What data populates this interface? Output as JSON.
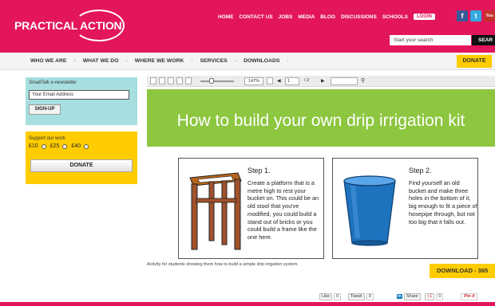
{
  "header": {
    "logo": "PRACTICAL ACTION",
    "nav": [
      "HOME",
      "CONTACT US",
      "JOBS",
      "MEDIA",
      "BLOG",
      "DISCUSSIONS",
      "SCHOOLS"
    ],
    "login_label": "LOGIN",
    "search_placeholder": "Start your search",
    "search_button": "SEAR",
    "social": {
      "facebook": "f",
      "twitter": "t",
      "youtube": "You"
    },
    "brand_color": "#e3165b"
  },
  "mainnav": {
    "items": [
      "WHO WE ARE",
      "WHAT WE DO",
      "WHERE WE WORK",
      "SERVICES",
      "DOWNLOADS"
    ],
    "separator": "›",
    "donate": "DONATE"
  },
  "sidebar": {
    "newsletter": {
      "title": "SmallTalk e-newsletter",
      "email_value": "Your Email Address",
      "signup": "SIGN-UP"
    },
    "support": {
      "title": "Support our work",
      "amounts": [
        "£10",
        "£25",
        "£40"
      ],
      "donate": "DONATE"
    }
  },
  "viewer": {
    "zoom": "147%",
    "page": "1",
    "of": "/ 2",
    "prev": "◀",
    "next": "▶",
    "search_icon": "🔍"
  },
  "document": {
    "title": "How to build your own drip irrigation kit",
    "steps": [
      {
        "head": "Step 1.",
        "text": "Create a platform that is a metre high to rest your bucket on. This could be an old stool that you've modified, you could build a stand out of bricks or you could build a frame like the one here."
      },
      {
        "head": "Step 2.",
        "text": "Find yourself an old bucket and make three holes in the bottom of it, big enough to fit a piece of hosepipe through, but not too big that it falls out."
      }
    ],
    "green": "#8dc63f"
  },
  "caption": "Activity for students showing them how to build a simple drip irrigation system.",
  "download": "DOWNLOAD - 365",
  "share": {
    "like": "Like",
    "like_count": "0",
    "tweet": "Tweet",
    "tweet_count": "0",
    "linkedin": "in",
    "linkedin_label": "Share",
    "gplus": "+1",
    "gplus_count": "0",
    "pin": "Pin it"
  }
}
